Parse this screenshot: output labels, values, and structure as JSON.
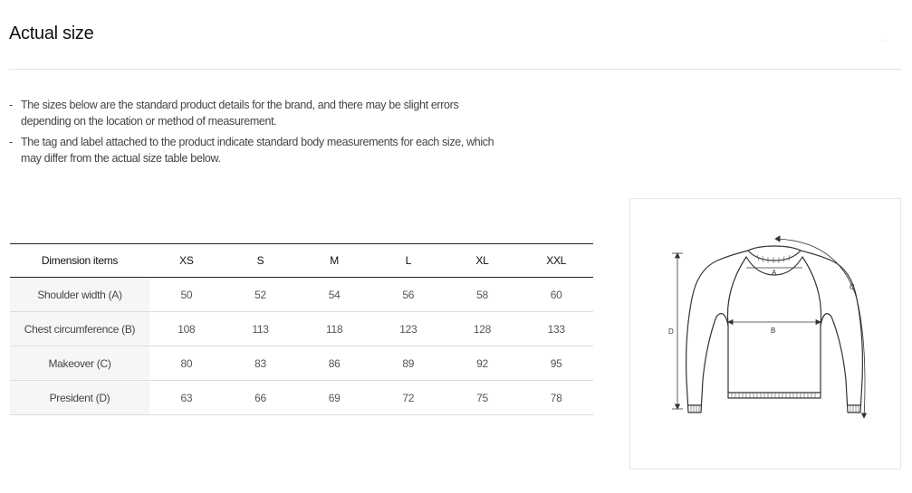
{
  "header": {
    "title": "Actual size",
    "corner_mark": "· ·"
  },
  "notes": [
    {
      "dash": "-",
      "text": "The sizes below are the standard product details for the brand, and there may be slight errors depending on the location or method of measurement."
    },
    {
      "dash": "-",
      "text": "The tag and label attached to the product indicate standard body measurements for each size, which may differ from the actual size table below."
    }
  ],
  "table": {
    "headers": [
      "Dimension items",
      "XS",
      "S",
      "M",
      "L",
      "XL",
      "XXL"
    ],
    "rows": [
      {
        "label": "Shoulder width (A)",
        "values": [
          "50",
          "52",
          "54",
          "56",
          "58",
          "60"
        ]
      },
      {
        "label": "Chest circumference (B)",
        "values": [
          "108",
          "113",
          "118",
          "123",
          "128",
          "133"
        ]
      },
      {
        "label": "Makeover (C)",
        "values": [
          "80",
          "83",
          "86",
          "89",
          "92",
          "95"
        ]
      },
      {
        "label": "President (D)",
        "values": [
          "63",
          "66",
          "69",
          "72",
          "75",
          "78"
        ]
      }
    ]
  },
  "diagram": {
    "labels": {
      "a": "A",
      "b": "B",
      "c": "C",
      "d": "D"
    },
    "stroke_color": "#333333"
  }
}
